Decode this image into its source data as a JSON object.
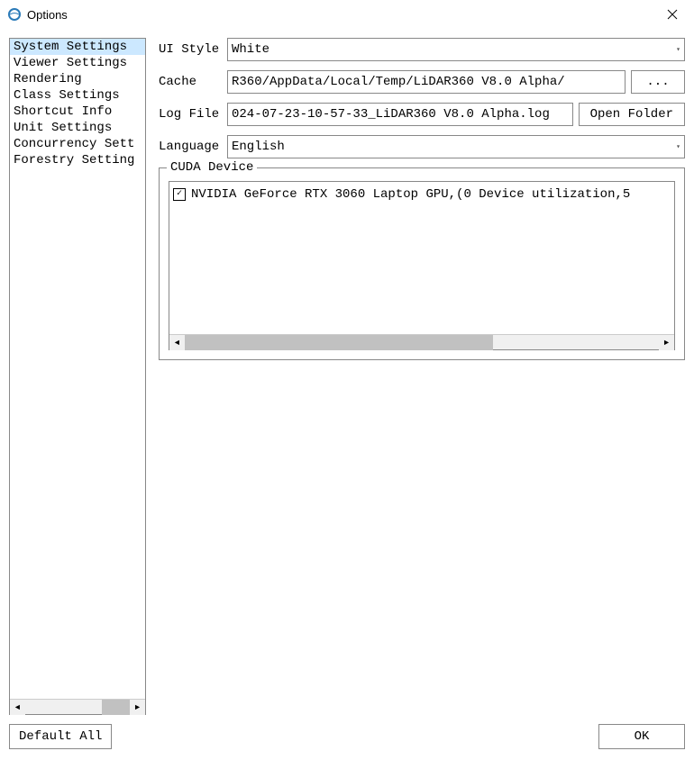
{
  "window": {
    "title": "Options"
  },
  "sidebar": {
    "items": [
      {
        "label": "System Settings",
        "selected": true
      },
      {
        "label": "Viewer Settings",
        "selected": false
      },
      {
        "label": "Rendering",
        "selected": false
      },
      {
        "label": "Class Settings",
        "selected": false
      },
      {
        "label": "Shortcut Info",
        "selected": false
      },
      {
        "label": "Unit Settings",
        "selected": false
      },
      {
        "label": "Concurrency Sett",
        "selected": false
      },
      {
        "label": "Forestry Setting",
        "selected": false
      }
    ]
  },
  "form": {
    "ui_style_label": "UI Style",
    "ui_style_value": "White",
    "cache_label": "Cache",
    "cache_value": "R360/AppData/Local/Temp/LiDAR360 V8.0 Alpha/",
    "cache_browse": "...",
    "logfile_label": "Log File",
    "logfile_value": "024-07-23-10-57-33_LiDAR360 V8.0 Alpha.log",
    "open_folder": "Open Folder",
    "language_label": "Language",
    "language_value": "English"
  },
  "cuda": {
    "legend": "CUDA Device",
    "devices": [
      {
        "checked": true,
        "label": "NVIDIA GeForce RTX 3060 Laptop GPU,(0 Device utilization,5"
      }
    ]
  },
  "footer": {
    "default_all": "Default All",
    "ok": "OK"
  }
}
